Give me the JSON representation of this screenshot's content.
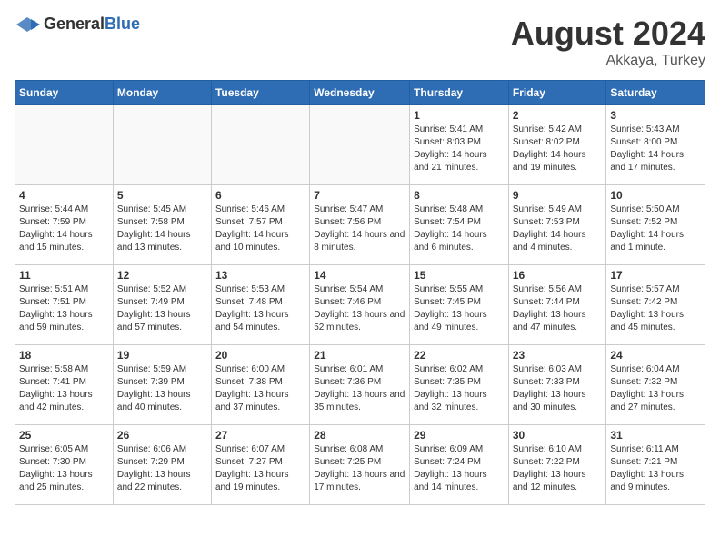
{
  "header": {
    "logo_general": "General",
    "logo_blue": "Blue",
    "month_year": "August 2024",
    "location": "Akkaya, Turkey"
  },
  "weekdays": [
    "Sunday",
    "Monday",
    "Tuesday",
    "Wednesday",
    "Thursday",
    "Friday",
    "Saturday"
  ],
  "weeks": [
    [
      {
        "day": "",
        "info": ""
      },
      {
        "day": "",
        "info": ""
      },
      {
        "day": "",
        "info": ""
      },
      {
        "day": "",
        "info": ""
      },
      {
        "day": "1",
        "info": "Sunrise: 5:41 AM\nSunset: 8:03 PM\nDaylight: 14 hours and 21 minutes."
      },
      {
        "day": "2",
        "info": "Sunrise: 5:42 AM\nSunset: 8:02 PM\nDaylight: 14 hours and 19 minutes."
      },
      {
        "day": "3",
        "info": "Sunrise: 5:43 AM\nSunset: 8:00 PM\nDaylight: 14 hours and 17 minutes."
      }
    ],
    [
      {
        "day": "4",
        "info": "Sunrise: 5:44 AM\nSunset: 7:59 PM\nDaylight: 14 hours and 15 minutes."
      },
      {
        "day": "5",
        "info": "Sunrise: 5:45 AM\nSunset: 7:58 PM\nDaylight: 14 hours and 13 minutes."
      },
      {
        "day": "6",
        "info": "Sunrise: 5:46 AM\nSunset: 7:57 PM\nDaylight: 14 hours and 10 minutes."
      },
      {
        "day": "7",
        "info": "Sunrise: 5:47 AM\nSunset: 7:56 PM\nDaylight: 14 hours and 8 minutes."
      },
      {
        "day": "8",
        "info": "Sunrise: 5:48 AM\nSunset: 7:54 PM\nDaylight: 14 hours and 6 minutes."
      },
      {
        "day": "9",
        "info": "Sunrise: 5:49 AM\nSunset: 7:53 PM\nDaylight: 14 hours and 4 minutes."
      },
      {
        "day": "10",
        "info": "Sunrise: 5:50 AM\nSunset: 7:52 PM\nDaylight: 14 hours and 1 minute."
      }
    ],
    [
      {
        "day": "11",
        "info": "Sunrise: 5:51 AM\nSunset: 7:51 PM\nDaylight: 13 hours and 59 minutes."
      },
      {
        "day": "12",
        "info": "Sunrise: 5:52 AM\nSunset: 7:49 PM\nDaylight: 13 hours and 57 minutes."
      },
      {
        "day": "13",
        "info": "Sunrise: 5:53 AM\nSunset: 7:48 PM\nDaylight: 13 hours and 54 minutes."
      },
      {
        "day": "14",
        "info": "Sunrise: 5:54 AM\nSunset: 7:46 PM\nDaylight: 13 hours and 52 minutes."
      },
      {
        "day": "15",
        "info": "Sunrise: 5:55 AM\nSunset: 7:45 PM\nDaylight: 13 hours and 49 minutes."
      },
      {
        "day": "16",
        "info": "Sunrise: 5:56 AM\nSunset: 7:44 PM\nDaylight: 13 hours and 47 minutes."
      },
      {
        "day": "17",
        "info": "Sunrise: 5:57 AM\nSunset: 7:42 PM\nDaylight: 13 hours and 45 minutes."
      }
    ],
    [
      {
        "day": "18",
        "info": "Sunrise: 5:58 AM\nSunset: 7:41 PM\nDaylight: 13 hours and 42 minutes."
      },
      {
        "day": "19",
        "info": "Sunrise: 5:59 AM\nSunset: 7:39 PM\nDaylight: 13 hours and 40 minutes."
      },
      {
        "day": "20",
        "info": "Sunrise: 6:00 AM\nSunset: 7:38 PM\nDaylight: 13 hours and 37 minutes."
      },
      {
        "day": "21",
        "info": "Sunrise: 6:01 AM\nSunset: 7:36 PM\nDaylight: 13 hours and 35 minutes."
      },
      {
        "day": "22",
        "info": "Sunrise: 6:02 AM\nSunset: 7:35 PM\nDaylight: 13 hours and 32 minutes."
      },
      {
        "day": "23",
        "info": "Sunrise: 6:03 AM\nSunset: 7:33 PM\nDaylight: 13 hours and 30 minutes."
      },
      {
        "day": "24",
        "info": "Sunrise: 6:04 AM\nSunset: 7:32 PM\nDaylight: 13 hours and 27 minutes."
      }
    ],
    [
      {
        "day": "25",
        "info": "Sunrise: 6:05 AM\nSunset: 7:30 PM\nDaylight: 13 hours and 25 minutes."
      },
      {
        "day": "26",
        "info": "Sunrise: 6:06 AM\nSunset: 7:29 PM\nDaylight: 13 hours and 22 minutes."
      },
      {
        "day": "27",
        "info": "Sunrise: 6:07 AM\nSunset: 7:27 PM\nDaylight: 13 hours and 19 minutes."
      },
      {
        "day": "28",
        "info": "Sunrise: 6:08 AM\nSunset: 7:25 PM\nDaylight: 13 hours and 17 minutes."
      },
      {
        "day": "29",
        "info": "Sunrise: 6:09 AM\nSunset: 7:24 PM\nDaylight: 13 hours and 14 minutes."
      },
      {
        "day": "30",
        "info": "Sunrise: 6:10 AM\nSunset: 7:22 PM\nDaylight: 13 hours and 12 minutes."
      },
      {
        "day": "31",
        "info": "Sunrise: 6:11 AM\nSunset: 7:21 PM\nDaylight: 13 hours and 9 minutes."
      }
    ]
  ]
}
